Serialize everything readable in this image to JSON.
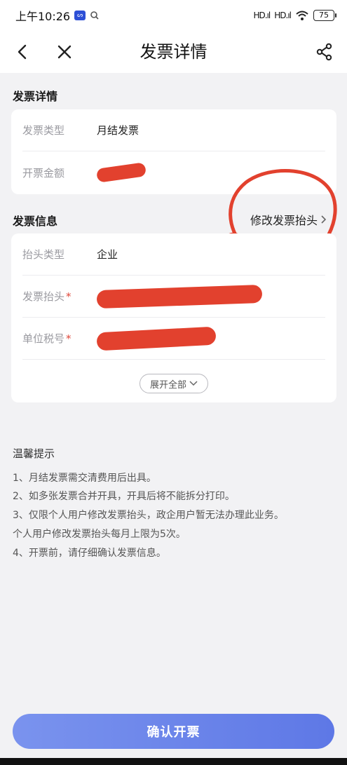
{
  "status_bar": {
    "time": "上午10:26",
    "app_badge": "ᔕ",
    "signal1": "HD.ıl",
    "signal2": "HD.ıl",
    "battery": "75"
  },
  "nav": {
    "title": "发票详情"
  },
  "invoice_details": {
    "section_title": "发票详情",
    "type_label": "发票类型",
    "type_value": "月结发票",
    "amount_label": "开票金额"
  },
  "invoice_info": {
    "section_title": "发票信息",
    "edit_link": "修改发票抬头",
    "header_type_label": "抬头类型",
    "header_type_value": "企业",
    "header_label": "发票抬头",
    "tax_id_label": "单位税号",
    "required_mark": "*",
    "expand_label": "展开全部"
  },
  "tips": {
    "title": "温馨提示",
    "lines": [
      "1、月结发票需交清费用后出具。",
      "2、如多张发票合并开具，开具后将不能拆分打印。",
      "3、仅限个人用户修改发票抬头，政企用户暂无法办理此业务。",
      "个人用户修改发票抬头每月上限为5次。",
      "4、开票前，请仔细确认发票信息。"
    ]
  },
  "confirm_button": "确认开票",
  "colors": {
    "accent": "#6a84ea",
    "redact": "#e2412e",
    "required": "#e0483a"
  }
}
